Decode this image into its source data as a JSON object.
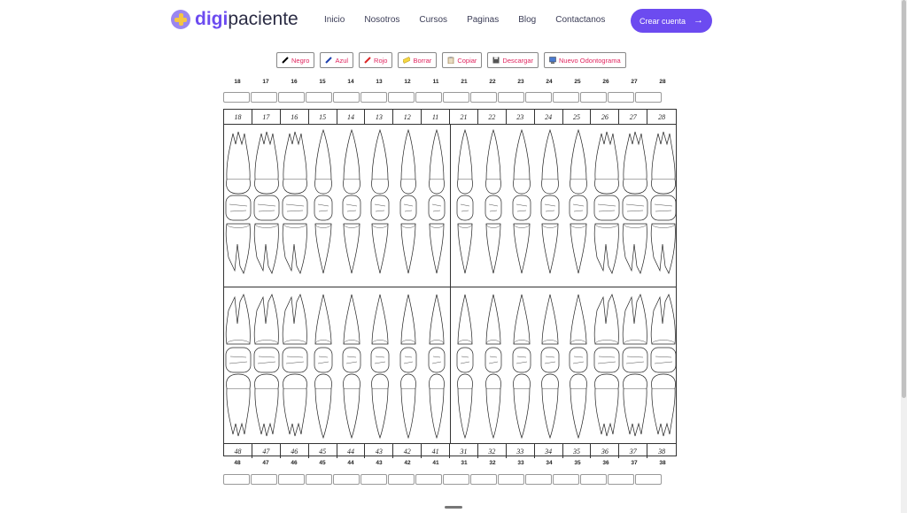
{
  "header": {
    "logo_bold": "digi",
    "logo_rest": "paciente",
    "nav": [
      "Inicio",
      "Nosotros",
      "Cursos",
      "Paginas",
      "Blog",
      "Contactanos"
    ],
    "cta_label": "Crear cuenta",
    "cta_icon": "arrow-right-icon"
  },
  "toolbar": {
    "buttons": [
      {
        "label": "Negro",
        "icon": "pencil-icon",
        "color": "#000000"
      },
      {
        "label": "Azul",
        "icon": "pencil-icon",
        "color": "#1e40af"
      },
      {
        "label": "Rojo",
        "icon": "pencil-icon",
        "color": "#dc2626"
      },
      {
        "label": "Borrar",
        "icon": "eraser-icon"
      },
      {
        "label": "Copiar",
        "icon": "clipboard-icon"
      },
      {
        "label": "Descargar",
        "icon": "floppy-disk-icon"
      },
      {
        "label": "Nuevo Odontograma",
        "icon": "computer-icon"
      }
    ]
  },
  "upper_teeth": [
    "18",
    "17",
    "16",
    "15",
    "14",
    "13",
    "12",
    "11",
    "21",
    "22",
    "23",
    "24",
    "25",
    "26",
    "27",
    "28"
  ],
  "lower_teeth": [
    "48",
    "47",
    "46",
    "45",
    "44",
    "43",
    "42",
    "41",
    "31",
    "32",
    "33",
    "34",
    "35",
    "36",
    "37",
    "38"
  ],
  "colors": {
    "accent": "#6c4bf0",
    "button_text": "#e0245e",
    "logo_mark": "#9a86f0",
    "logo_cross": "#f5c542"
  }
}
